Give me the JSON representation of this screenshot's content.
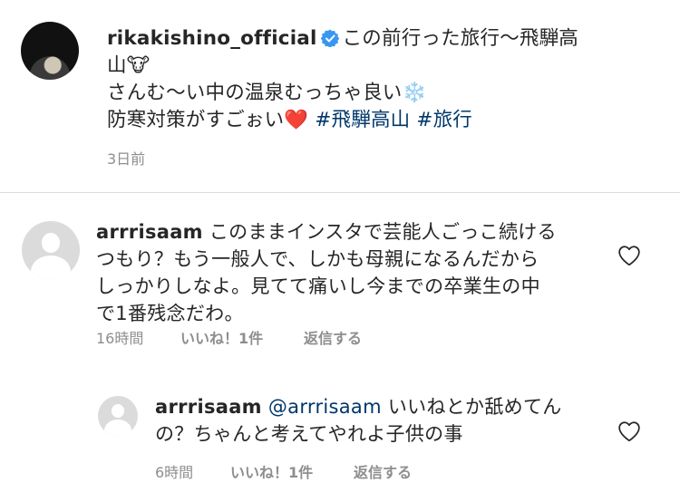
{
  "post": {
    "username": "rikakishino_official",
    "caption_line1": "この前行った旅行〜飛騨高",
    "caption_line2": "山🐮",
    "caption_line3": "さんむ〜い中の温泉むっちゃ良い❄️",
    "caption_line4_text": "防寒対策がすごぉい❤️",
    "hashtag1": "#飛騨高山",
    "hashtag2": "#旅行",
    "time": "3日前"
  },
  "comments": [
    {
      "username": "arrrisaam",
      "line1": "このままインスタで芸能人ごっこ続ける",
      "line2": "つもり？もう一般人で、しかも母親になるんだから",
      "line3": "しっかりしなよ。見てて痛いし今までの卒業生の中",
      "line4": "で1番残念だわ。",
      "time": "16時間",
      "likes": "いいね！1件",
      "reply": "返信する"
    },
    {
      "username": "arrrisaam",
      "mention": "@arrrisaam",
      "line1": "いいねとか舐めてん",
      "line2": "の？ちゃんと考えてやれよ子供の事",
      "time": "6時間",
      "likes": "いいね！1件",
      "reply": "返信する"
    }
  ],
  "icons": {
    "verified": "verified-badge-icon",
    "like": "heart-outline-icon"
  },
  "colors": {
    "hashtag": "#00376b",
    "verified": "#3897f0",
    "meta": "#8e8e8e"
  }
}
